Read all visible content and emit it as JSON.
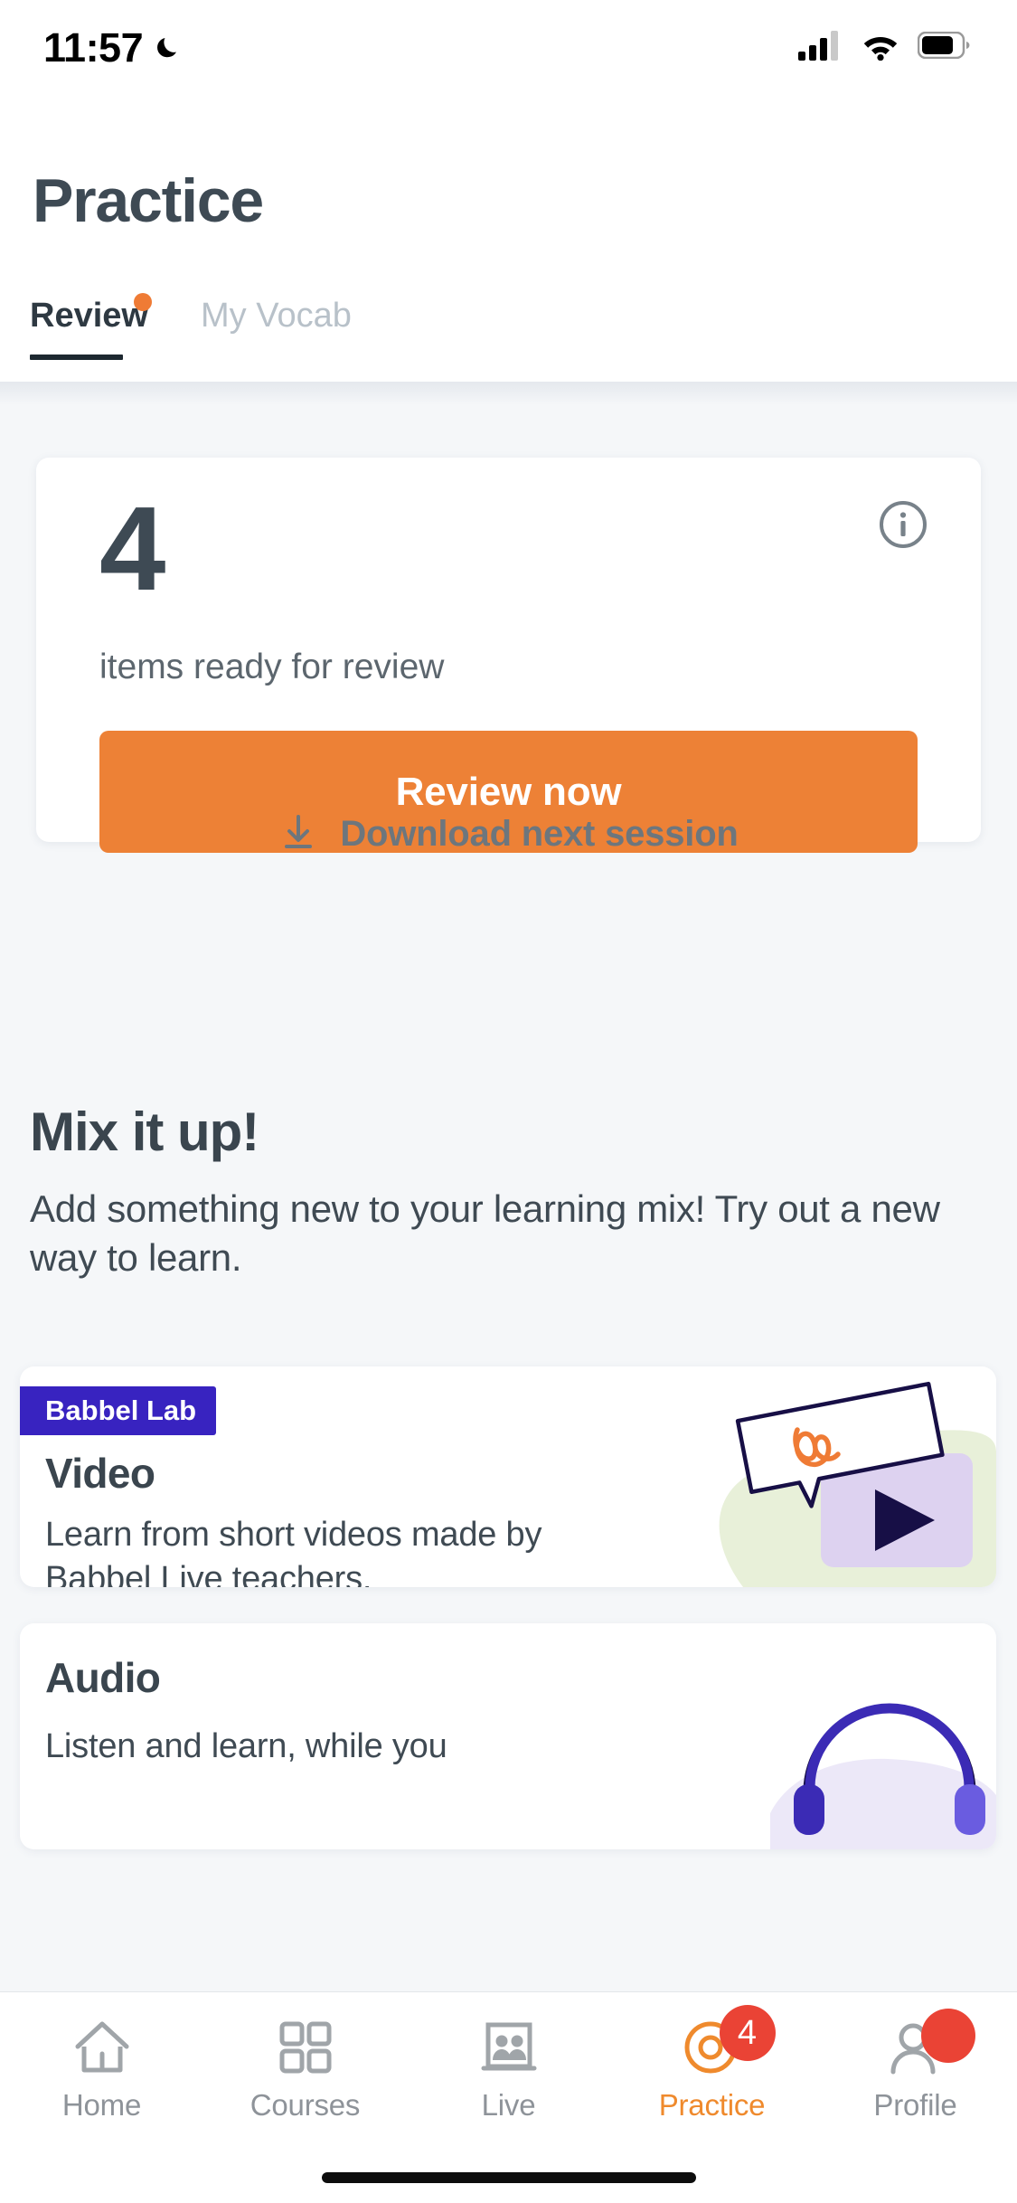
{
  "status_bar": {
    "time": "11:57",
    "moon_icon": "crescent-moon-icon",
    "cellular_icon": "cellular-signal-icon",
    "wifi_icon": "wifi-icon",
    "battery_icon": "battery-icon"
  },
  "header": {
    "title": "Practice"
  },
  "tabs": [
    {
      "label": "Review",
      "active": true,
      "has_dot": true
    },
    {
      "label": "My Vocab",
      "active": false,
      "has_dot": false
    }
  ],
  "review_card": {
    "count": "4",
    "subtitle": "items ready for review",
    "primary_button": "Review now",
    "download_link": "Download next session",
    "info_icon": "info-circle-icon",
    "download_icon": "download-icon"
  },
  "mix_section": {
    "title": "Mix it up!",
    "description": "Add something new to your learning mix! Try out a new way to learn."
  },
  "mix_cards": [
    {
      "badge": "Babbel Lab",
      "title": "Video",
      "description": "Learn from short videos made by  Babbel Live teachers.",
      "art": "video-illustration"
    },
    {
      "badge": "",
      "title": "Audio",
      "description": "Listen and learn, while you",
      "art": "audio-headphones-illustration"
    }
  ],
  "bottom_nav": [
    {
      "label": "Home",
      "icon": "home-icon",
      "active": false,
      "badge": ""
    },
    {
      "label": "Courses",
      "icon": "grid-icon",
      "active": false,
      "badge": ""
    },
    {
      "label": "Live",
      "icon": "live-people-icon",
      "active": false,
      "badge": ""
    },
    {
      "label": "Practice",
      "icon": "target-icon",
      "active": true,
      "badge": "4"
    },
    {
      "label": "Profile",
      "icon": "person-icon",
      "active": false,
      "badge": "dot"
    }
  ],
  "colors": {
    "accent_orange": "#ed8136",
    "badge_purple": "#3823c0",
    "badge_red": "#ea4335",
    "text_dark": "#3a454e",
    "text_muted": "#5c666e",
    "page_bg": "#f5f7f9"
  }
}
